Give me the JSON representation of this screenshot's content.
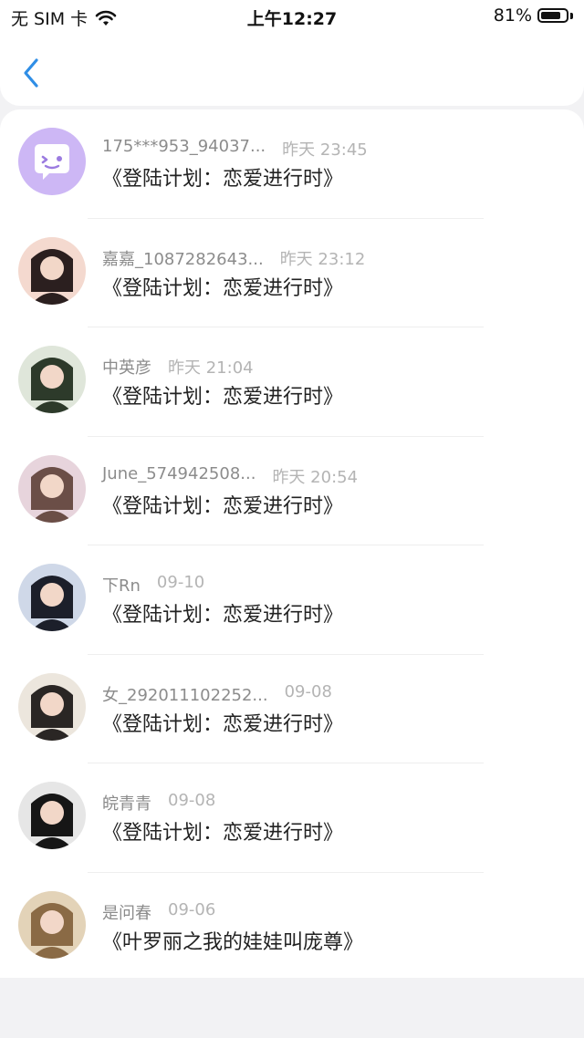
{
  "status_bar": {
    "carrier": "无 SIM 卡",
    "time": "上午12:27",
    "battery": "81%",
    "battery_level": 0.81
  },
  "nav": {
    "back_icon": "chevron-left-icon",
    "accent": "#2f8ee6"
  },
  "items": [
    {
      "name": "175***953_94037...",
      "time": "昨天 23:45",
      "title": "《登陆计划：恋爱进行时》",
      "avatar": "default-chat-avatar"
    },
    {
      "name": "嘉嘉_1087282643...",
      "time": "昨天 23:12",
      "title": "《登陆计划：恋爱进行时》",
      "avatar": "user-photo"
    },
    {
      "name": "中英彦",
      "time": "昨天 21:04",
      "title": "《登陆计划：恋爱进行时》",
      "avatar": "user-photo"
    },
    {
      "name": "June_574942508...",
      "time": "昨天 20:54",
      "title": "《登陆计划：恋爱进行时》",
      "avatar": "user-photo"
    },
    {
      "name": "下Rn",
      "time": "09-10",
      "title": "《登陆计划：恋爱进行时》",
      "avatar": "user-photo"
    },
    {
      "name": "女_292011102252...",
      "time": "09-08",
      "title": "《登陆计划：恋爱进行时》",
      "avatar": "user-photo"
    },
    {
      "name": "皖青青",
      "time": "09-08",
      "title": "《登陆计划：恋爱进行时》",
      "avatar": "user-photo"
    },
    {
      "name": "是问春",
      "time": "09-06",
      "title": "《叶罗丽之我的娃娃叫庞尊》",
      "avatar": "user-photo"
    }
  ]
}
